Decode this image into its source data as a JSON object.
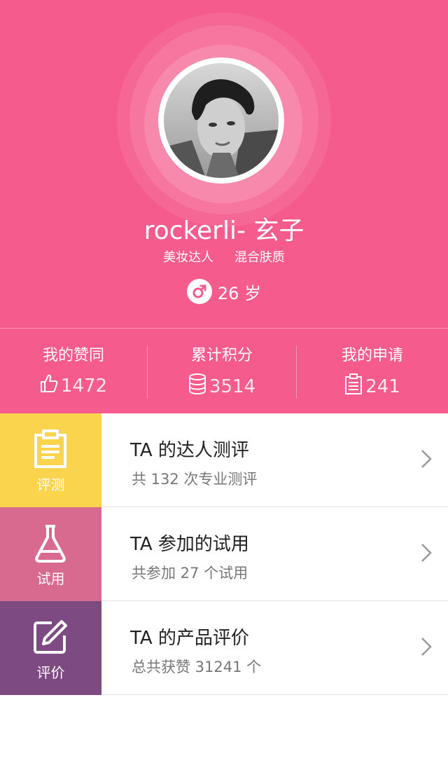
{
  "profile": {
    "name": "rockerli- 玄子",
    "tag1": "美妆达人",
    "tag2": "混合肤质",
    "age": "26 岁"
  },
  "stats": {
    "likes": {
      "label": "我的赞同",
      "value": "1472"
    },
    "points": {
      "label": "累计积分",
      "value": "3514"
    },
    "applications": {
      "label": "我的申请",
      "value": "241"
    }
  },
  "menu": [
    {
      "tile_label": "评测",
      "title": "TA 的达人测评",
      "subtitle": "共 132 次专业测评",
      "color": "#f9d44c"
    },
    {
      "tile_label": "试用",
      "title": "TA 参加的试用",
      "subtitle": "共参加 27 个试用",
      "color": "#d96a8f"
    },
    {
      "tile_label": "评价",
      "title": "TA 的产品评价",
      "subtitle": "总共获赞 31241 个",
      "color": "#7e4a82"
    }
  ],
  "colors": {
    "header": "#f55b8c"
  }
}
